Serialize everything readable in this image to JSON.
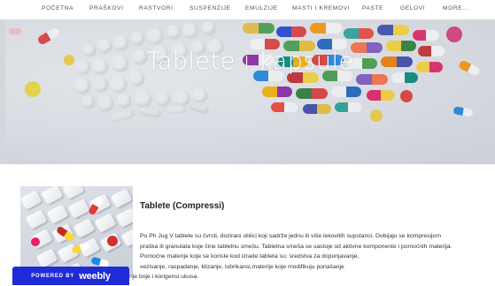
{
  "nav": {
    "items": [
      "POČETNA",
      "PRAŠKOVI",
      "RASTVORI",
      "SUSPENZIJE",
      "EMULZIJE",
      "MASTI I KREMOVI",
      "PASTE",
      "GELOVI",
      "MORE..."
    ]
  },
  "hero": {
    "title": "Tablete i kapsule"
  },
  "article": {
    "title": "Tablete (Compressi)",
    "paragraphs": [
      "Po Ph Jug V tablete su čvrsti, dozirani oblici koji sadrže jednu ili više lekovitih supstanci. Dobijaju se kompresijom",
      "praška ili granulata koje čine tabletnu smešu. Tabletna smeša se sastoje od aktivne komponente i pomoćnih materija.",
      "Pomoćne materije koje se koriste kod izrade tableta su: sredstva za dopunjavanje,",
      "vezivanje, raspadanje, klizanje, lubrikansi,materije koje modifikuju ponašanje",
      "nje boje i korigensi ukusa."
    ]
  },
  "badge": {
    "powered": "POWERED BY",
    "brand": "weebly"
  },
  "colors": {
    "badge_bg": "#1f2bd6",
    "nav_text": "#555555",
    "hero_title": "#ffffff"
  }
}
